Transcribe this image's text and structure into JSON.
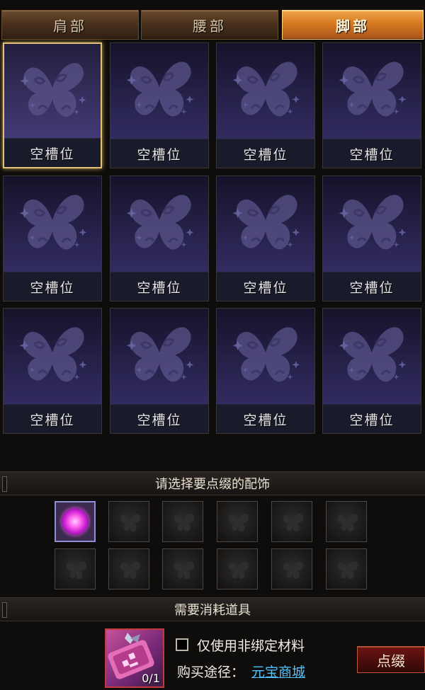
{
  "tabs": [
    {
      "label": "肩部",
      "active": false
    },
    {
      "label": "腰部",
      "active": false
    },
    {
      "label": "脚部",
      "active": true
    }
  ],
  "slots": [
    {
      "label": "空槽位",
      "selected": true
    },
    {
      "label": "空槽位"
    },
    {
      "label": "空槽位"
    },
    {
      "label": "空槽位"
    },
    {
      "label": "空槽位"
    },
    {
      "label": "空槽位"
    },
    {
      "label": "空槽位"
    },
    {
      "label": "空槽位"
    },
    {
      "label": "空槽位"
    },
    {
      "label": "空槽位"
    },
    {
      "label": "空槽位"
    },
    {
      "label": "空槽位"
    }
  ],
  "slot_icon": "butterfly-icon",
  "accessory_section": {
    "title": "请选择要点缀的配饰",
    "items": [
      {
        "icon": "purple-orb-icon",
        "filled": true
      },
      {
        "icon": "butterfly-icon"
      },
      {
        "icon": "butterfly-icon"
      },
      {
        "icon": "butterfly-icon"
      },
      {
        "icon": "butterfly-icon"
      },
      {
        "icon": "butterfly-icon"
      },
      {
        "icon": "butterfly-icon"
      },
      {
        "icon": "butterfly-icon"
      },
      {
        "icon": "butterfly-icon"
      },
      {
        "icon": "butterfly-icon"
      },
      {
        "icon": "butterfly-icon"
      },
      {
        "icon": "butterfly-icon"
      }
    ]
  },
  "consume_section": {
    "title": "需要消耗道具",
    "item_icon": "material-scroll-icon",
    "item_count": "0/1",
    "checkbox_label": "仅使用非绑定材料",
    "checkbox_checked": false,
    "buy_label": "购买途径：",
    "buy_link": "元宝商城",
    "action_button": "点缀"
  },
  "colors": {
    "active_tab": "#d77b21",
    "slot_bg": "#2a2552",
    "link": "#4fc3ff",
    "orb": "#ff66ee",
    "action_button": "#4a0d0b"
  }
}
